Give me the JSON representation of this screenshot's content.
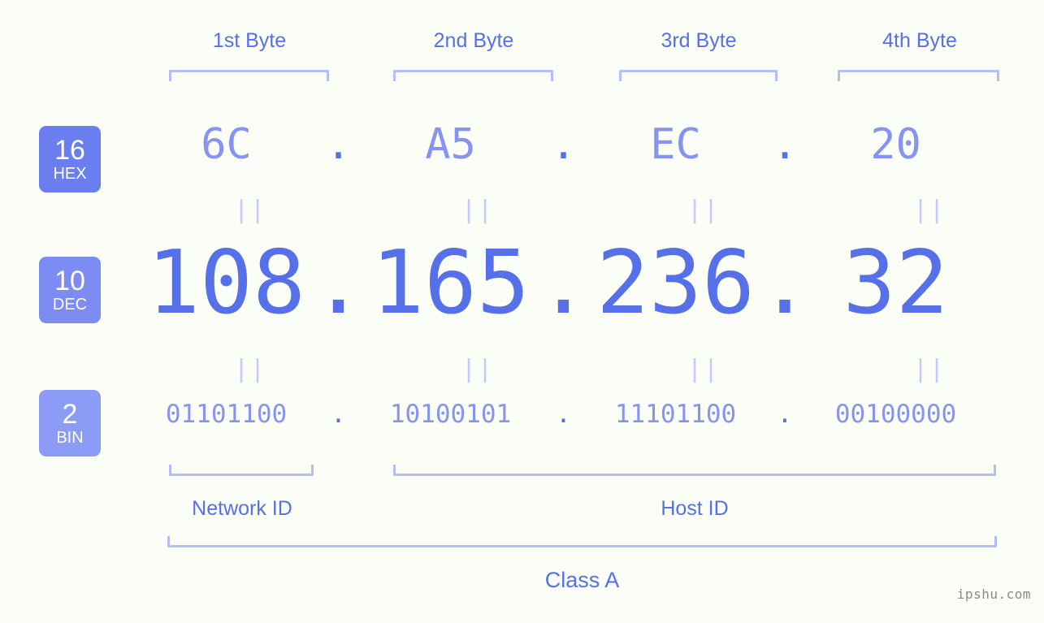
{
  "background_color": "#fbfdf7",
  "accent_color": "#5570e8",
  "accent_light_color": "#8593f2",
  "bracket_color": "#b3bdf7",
  "byte_headers": [
    {
      "label": "1st Byte"
    },
    {
      "label": "2nd Byte"
    },
    {
      "label": "3rd Byte"
    },
    {
      "label": "4th Byte"
    }
  ],
  "rows": {
    "hex": {
      "badge_number": "16",
      "badge_abbr": "HEX",
      "badge_color": "#6b7ef0",
      "separator": ".",
      "octets": [
        "6C",
        "A5",
        "EC",
        "20"
      ]
    },
    "dec": {
      "badge_number": "10",
      "badge_abbr": "DEC",
      "badge_color": "#7d8cf2",
      "separator": ".",
      "octets": [
        "108",
        "165",
        "236",
        "32"
      ]
    },
    "bin": {
      "badge_number": "2",
      "badge_abbr": "BIN",
      "badge_color": "#8c9bf5",
      "separator": ".",
      "octets": [
        "01101100",
        "10100101",
        "11101100",
        "00100000"
      ]
    }
  },
  "equals_marks": {
    "glyph": "||",
    "count_per_row": 4
  },
  "id_sections": {
    "network_id_label": "Network ID",
    "host_id_label": "Host ID"
  },
  "class_label": "Class A",
  "watermark": "ipshu.com"
}
